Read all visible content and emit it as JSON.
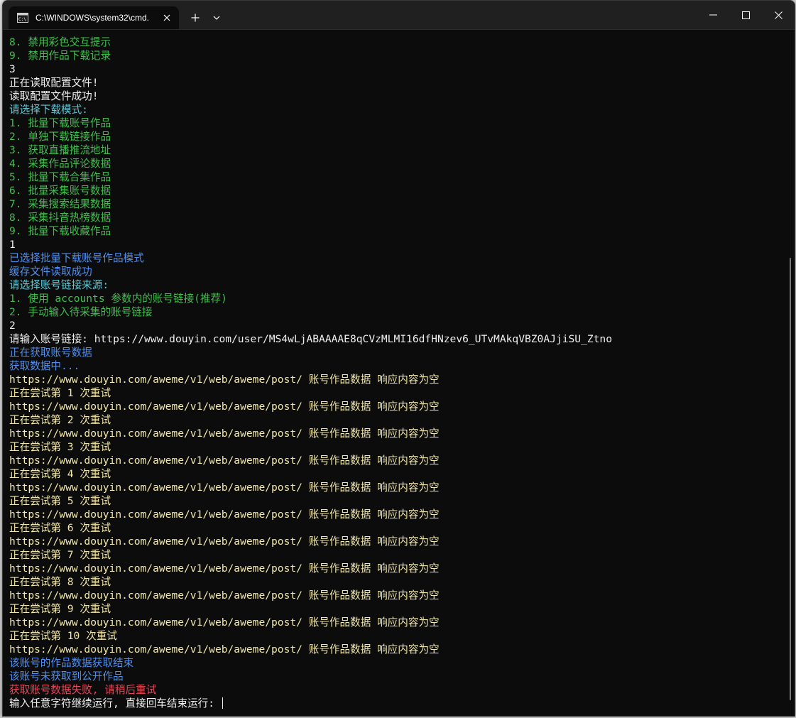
{
  "window": {
    "tab_title": "C:\\WINDOWS\\system32\\cmd.",
    "icons": {
      "tab": "terminal-icon",
      "close": "close-icon",
      "new_tab": "plus-icon",
      "dropdown": "chevron-down-icon",
      "minimize": "minimize-icon",
      "maximize": "maximize-icon",
      "window_close": "close-icon"
    }
  },
  "colors": {
    "green": "#3fbf4c",
    "white": "#efefef",
    "cyan": "#5fc9d6",
    "blue": "#4f8ff0",
    "yellow": "#f1e7a8",
    "red": "#e8475a",
    "background": "#0c0c0c"
  },
  "console": {
    "lines": [
      {
        "text": "8. 禁用彩色交互提示",
        "color": "green"
      },
      {
        "text": "9. 禁用作品下载记录",
        "color": "green"
      },
      {
        "text": "3",
        "color": "white"
      },
      {
        "text": "正在读取配置文件!",
        "color": "white"
      },
      {
        "text": "读取配置文件成功!",
        "color": "white"
      },
      {
        "text": "请选择下载模式:",
        "color": "cyan"
      },
      {
        "text": "1. 批量下载账号作品",
        "color": "green"
      },
      {
        "text": "2. 单独下载链接作品",
        "color": "green"
      },
      {
        "text": "3. 获取直播推流地址",
        "color": "green"
      },
      {
        "text": "4. 采集作品评论数据",
        "color": "green"
      },
      {
        "text": "5. 批量下载合集作品",
        "color": "green"
      },
      {
        "text": "6. 批量采集账号数据",
        "color": "green"
      },
      {
        "text": "7. 采集搜索结果数据",
        "color": "green"
      },
      {
        "text": "8. 采集抖音热榜数据",
        "color": "green"
      },
      {
        "text": "9. 批量下载收藏作品",
        "color": "green"
      },
      {
        "text": "1",
        "color": "white"
      },
      {
        "text": "已选择批量下载账号作品模式",
        "color": "blue"
      },
      {
        "text": "缓存文件读取成功",
        "color": "blue"
      },
      {
        "text": "请选择账号链接来源:",
        "color": "cyan"
      },
      {
        "text": "1. 使用 accounts 参数内的账号链接(推荐)",
        "color": "green"
      },
      {
        "text": "2. 手动输入待采集的账号链接",
        "color": "green"
      },
      {
        "text": "2",
        "color": "white"
      },
      {
        "text": "请输入账号链接: https://www.douyin.com/user/MS4wLjABAAAAE8qCVzMLMI16dfHNzev6_UTvMAkqVBZ0AJjiSU_Ztno",
        "color": "white"
      },
      {
        "text": "正在获取账号数据",
        "color": "blue"
      },
      {
        "text": "获取数据中...",
        "color": "blue"
      },
      {
        "text": "https://www.douyin.com/aweme/v1/web/aweme/post/ 账号作品数据 响应内容为空",
        "color": "yellow"
      },
      {
        "text": "正在尝试第 1 次重试",
        "color": "yellow"
      },
      {
        "text": "https://www.douyin.com/aweme/v1/web/aweme/post/ 账号作品数据 响应内容为空",
        "color": "yellow"
      },
      {
        "text": "正在尝试第 2 次重试",
        "color": "yellow"
      },
      {
        "text": "https://www.douyin.com/aweme/v1/web/aweme/post/ 账号作品数据 响应内容为空",
        "color": "yellow"
      },
      {
        "text": "正在尝试第 3 次重试",
        "color": "yellow"
      },
      {
        "text": "https://www.douyin.com/aweme/v1/web/aweme/post/ 账号作品数据 响应内容为空",
        "color": "yellow"
      },
      {
        "text": "正在尝试第 4 次重试",
        "color": "yellow"
      },
      {
        "text": "https://www.douyin.com/aweme/v1/web/aweme/post/ 账号作品数据 响应内容为空",
        "color": "yellow"
      },
      {
        "text": "正在尝试第 5 次重试",
        "color": "yellow"
      },
      {
        "text": "https://www.douyin.com/aweme/v1/web/aweme/post/ 账号作品数据 响应内容为空",
        "color": "yellow"
      },
      {
        "text": "正在尝试第 6 次重试",
        "color": "yellow"
      },
      {
        "text": "https://www.douyin.com/aweme/v1/web/aweme/post/ 账号作品数据 响应内容为空",
        "color": "yellow"
      },
      {
        "text": "正在尝试第 7 次重试",
        "color": "yellow"
      },
      {
        "text": "https://www.douyin.com/aweme/v1/web/aweme/post/ 账号作品数据 响应内容为空",
        "color": "yellow"
      },
      {
        "text": "正在尝试第 8 次重试",
        "color": "yellow"
      },
      {
        "text": "https://www.douyin.com/aweme/v1/web/aweme/post/ 账号作品数据 响应内容为空",
        "color": "yellow"
      },
      {
        "text": "正在尝试第 9 次重试",
        "color": "yellow"
      },
      {
        "text": "https://www.douyin.com/aweme/v1/web/aweme/post/ 账号作品数据 响应内容为空",
        "color": "yellow"
      },
      {
        "text": "正在尝试第 10 次重试",
        "color": "yellow"
      },
      {
        "text": "https://www.douyin.com/aweme/v1/web/aweme/post/ 账号作品数据 响应内容为空",
        "color": "yellow"
      },
      {
        "text": "该账号的作品数据获取结束",
        "color": "blue"
      },
      {
        "text": "该账号未获取到公开作品",
        "color": "blue"
      },
      {
        "text": "获取账号数据失败, 请稍后重试",
        "color": "red"
      }
    ],
    "prompt": "输入任意字符继续运行, 直接回车结束运行: "
  }
}
